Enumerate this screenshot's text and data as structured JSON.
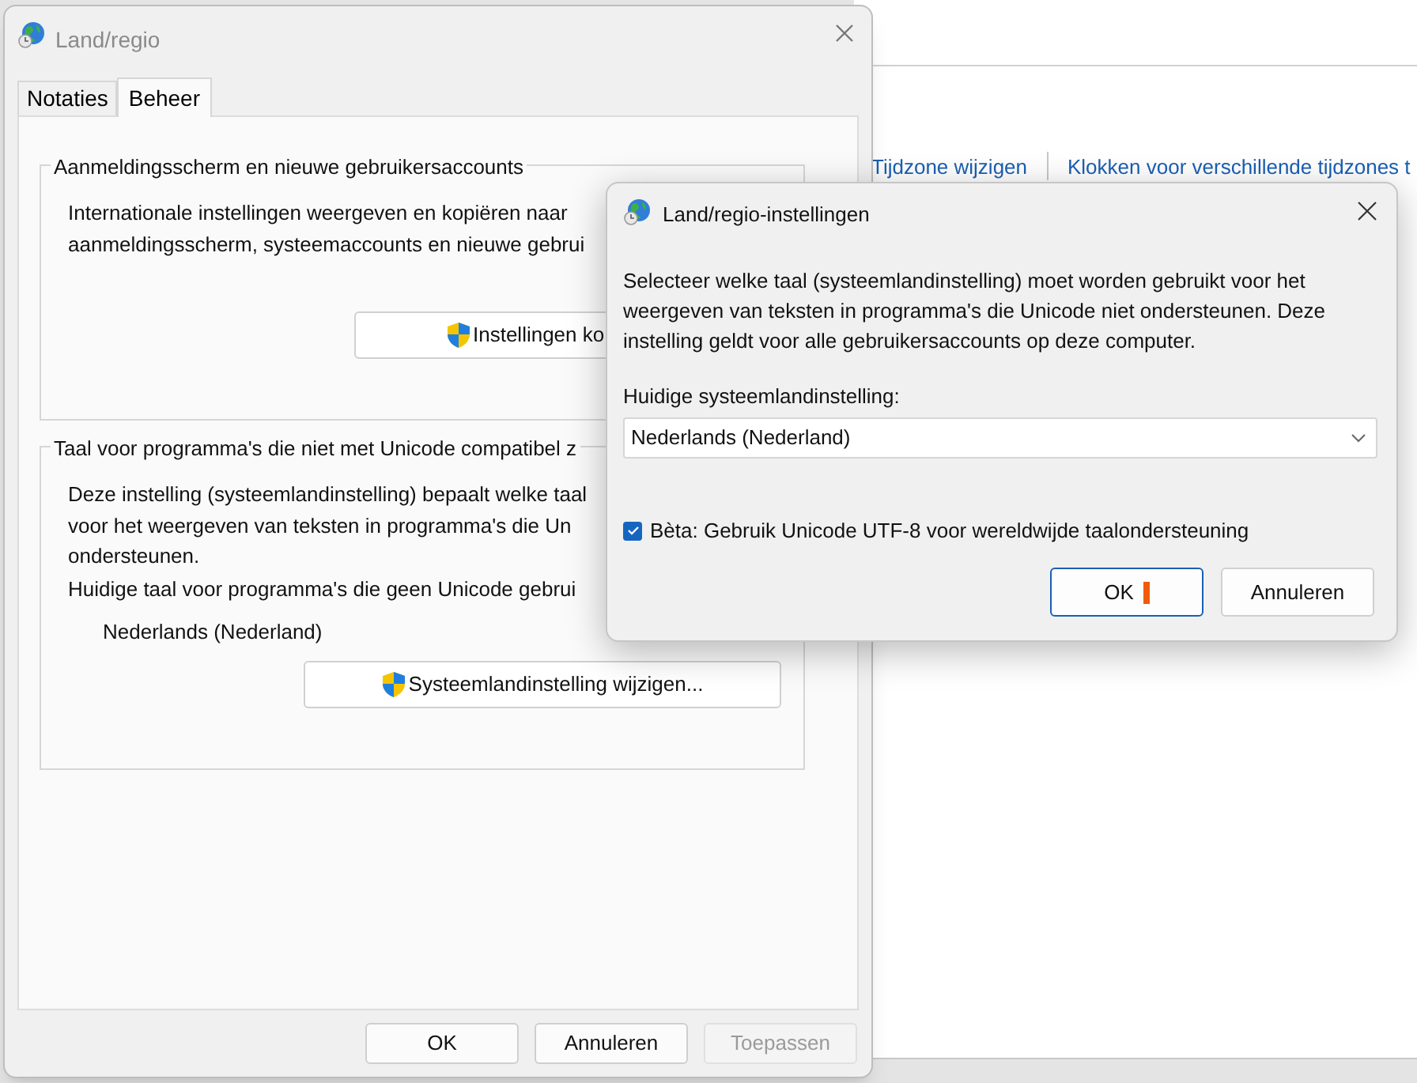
{
  "background_window": {
    "links": [
      "Tijdzone wijzigen",
      "Klokken voor verschillende tijdzones t"
    ]
  },
  "main_window": {
    "title": "Land/regio",
    "tabs": [
      {
        "label": "Notaties",
        "selected": false
      },
      {
        "label": "Beheer",
        "selected": true
      }
    ],
    "groups": [
      {
        "legend": "Aanmeldingsscherm en nieuwe gebruikersaccounts",
        "lines": [
          "Internationale instellingen weergeven en kopiëren naar",
          "aanmeldingsscherm, systeemaccounts en nieuwe gebrui"
        ],
        "button": "Instellingen ko"
      },
      {
        "legend": "Taal voor programma's die niet met Unicode compatibel z",
        "lines": [
          "Deze instelling (systeemlandinstelling) bepaalt welke taal",
          "voor het weergeven van teksten in programma's die Un",
          "ondersteunen.",
          "Huidige taal voor programma's die geen Unicode gebrui"
        ],
        "value": "Nederlands (Nederland)",
        "button": "Systeemlandinstelling wijzigen..."
      }
    ],
    "buttons": [
      {
        "label": "OK",
        "disabled": false
      },
      {
        "label": "Annuleren",
        "disabled": false
      },
      {
        "label": "Toepassen",
        "disabled": true
      }
    ]
  },
  "dialog": {
    "title": "Land/regio-instellingen",
    "description": "Selecteer welke taal (systeemlandinstelling) moet worden gebruikt voor het weergeven van teksten in programma's die Unicode niet ondersteunen. Deze instelling geldt voor alle gebruikersaccounts op deze computer.",
    "field_label": "Huidige systeemlandinstelling:",
    "locale_value": "Nederlands (Nederland)",
    "checkbox": {
      "label": "Bèta: Gebruik Unicode UTF-8 voor wereldwijde taalondersteuning",
      "checked": true
    },
    "buttons": [
      {
        "label": "OK",
        "default": true
      },
      {
        "label": "Annuleren",
        "default": false
      }
    ]
  }
}
